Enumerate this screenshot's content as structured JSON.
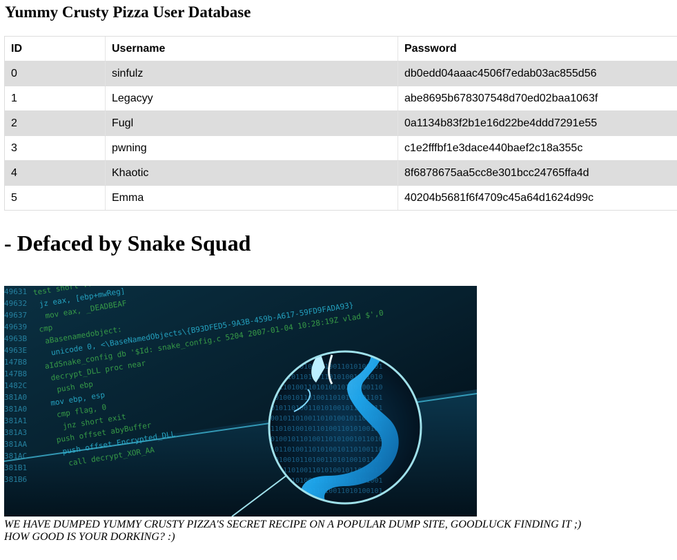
{
  "page": {
    "title": "Yummy Crusty Pizza User Database",
    "headline": "- Defaced by Snake Squad"
  },
  "table": {
    "headers": {
      "id": "ID",
      "username": "Username",
      "password": "Password"
    },
    "rows": [
      {
        "id": "0",
        "username": "sinfulz",
        "password": "db0edd04aaac4506f7edab03ac855d56"
      },
      {
        "id": "1",
        "username": "Legacyy",
        "password": "abe8695b678307548d70ed02baa1063f"
      },
      {
        "id": "2",
        "username": "Fugl",
        "password": "0a1134b83f2b1e16d22be4ddd7291e55"
      },
      {
        "id": "3",
        "username": "pwning",
        "password": "c1e2fffbf1e3dace440baef2c18a355c"
      },
      {
        "id": "4",
        "username": "Khaotic",
        "password": "8f6878675aa5cc8e301bcc24765ffa4d"
      },
      {
        "id": "5",
        "username": "Emma",
        "password": "40204b5681f6f4709c45a64d1624d99c"
      }
    ]
  },
  "banner": {
    "addresses": [
      "49631",
      "49632",
      "49637",
      "49639",
      "4963B",
      "4963E",
      "147B8",
      "147B8",
      "1482C",
      "381A0",
      "381A0",
      "381A1",
      "381A3",
      "381AA",
      "381AC",
      "381B1",
      "381B6"
    ],
    "code_lines": [
      "test     short ...",
      "jz       eax, [ebp+mwReg]",
      "mov      eax, _DEADBEAF",
      "cmp",
      "aBasenamedobject:",
      "unicode 0, <\\BaseNamedObjects\\{B93DFED5-9A3B-459b-A617-59FD9FADA93}",
      "aIdSnake_config db '$Id: snake_config.c 5204 2007-01-04 10:28:19Z vlad $',0",
      "decrypt_DLL proc near",
      "push     ebp",
      "mov      ebp, esp",
      "cmp      flag, 0",
      "jnz      short exit",
      "push     offset abyBuffer",
      "push     offset Encrypted_DLL",
      "call     decrypt_XOR_AA"
    ],
    "colors": {
      "background": "#041420",
      "code_green": "#3fae4a",
      "code_cyan": "#29b6d6",
      "snake_blue": "#1ea8f0",
      "lens_ring": "#9fe0ea"
    },
    "image_subject": "snake-over-code-illustration"
  },
  "message": {
    "line1": "WE HAVE DUMPED YUMMY CRUSTY PIZZA'S SECRET RECIPE ON A POPULAR DUMP SITE, GOODLUCK FINDING IT ;)",
    "line2": "HOW GOOD IS YOUR DORKING? :)"
  }
}
